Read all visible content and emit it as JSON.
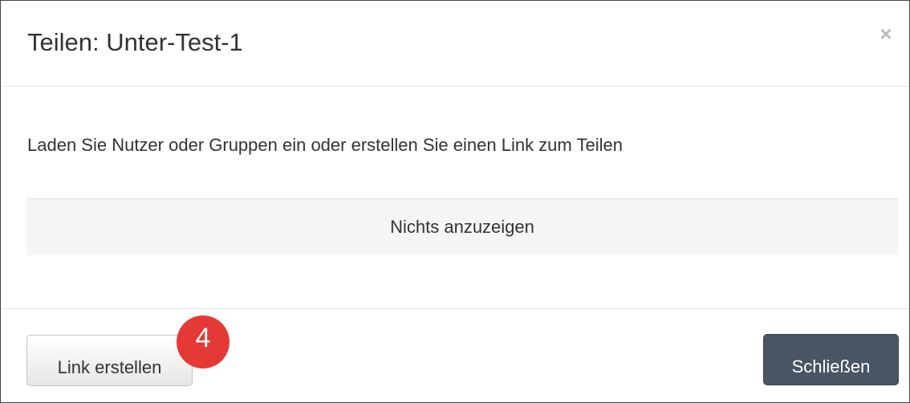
{
  "dialog": {
    "title": "Teilen: Unter-Test-1",
    "close_label": "×",
    "intro_text": "Laden Sie Nutzer oder Gruppen ein oder erstellen Sie einen Link zum Teilen",
    "empty_message": "Nichts anzuzeigen"
  },
  "footer": {
    "create_link_label": "Link erstellen",
    "close_label": "Schließen"
  },
  "annotation": {
    "step_number": "4",
    "badge_color": "#e53935"
  },
  "colors": {
    "primary_button": "#495563",
    "empty_box_bg": "#f5f5f5"
  },
  "icons": {
    "close": "close-icon"
  }
}
